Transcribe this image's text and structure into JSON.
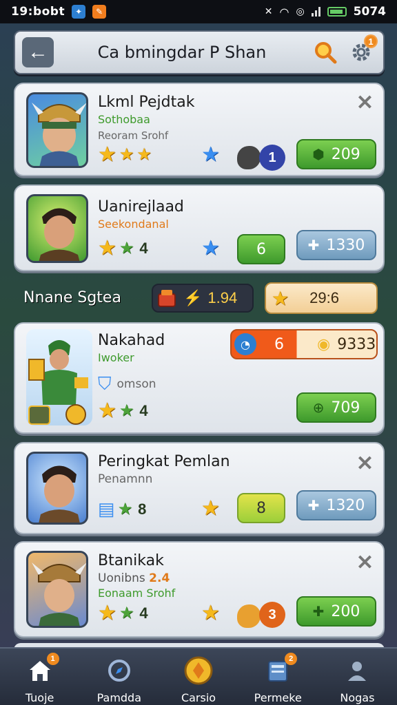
{
  "status_bar": {
    "time": "19:bobt",
    "right_text": "5074"
  },
  "header": {
    "back_icon": "arrow-left-icon",
    "title": "Ca bmingdar P Shan",
    "search_icon": "search-icon",
    "settings_icon": "gear-icon",
    "settings_badge": "1"
  },
  "cards": [
    {
      "name": "Lkml Pejdtak",
      "subtitle": "Sothobaa",
      "subtitle_color": "#3e9a2c",
      "note": "Reoram Srohf",
      "stars_text": "",
      "circle_value": "1",
      "circle_color": "#3344a8",
      "pill_value": "209",
      "pill_style": "green"
    },
    {
      "name": "Uanirejlaad",
      "subtitle": "Seekondanal",
      "subtitle_color": "#e07a1a",
      "stat": "4",
      "green_pill_value": "6",
      "blue_pill_value": "1330"
    },
    {
      "name": "Nakahad",
      "subtitle": "Iwoker",
      "subtitle_color": "#3e9a2c",
      "note": "omson",
      "stat": "4",
      "orange_pill_value": "6",
      "gold_pill_value": "9333",
      "green_pill_value": "709"
    },
    {
      "name": "Peringkat Pemlan",
      "subtitle": "Penamnn",
      "stat": "8",
      "yellow_pill_value": "8",
      "blue_pill_value": "1320"
    },
    {
      "name": "Btanikak",
      "subtitle": "Uonibns",
      "subtitle_suffix": "2.4",
      "note": "Eonaam Srohf",
      "stat": "4",
      "circle_value": "3",
      "circle_color": "#e0641a",
      "pill_value": "200"
    }
  ],
  "section": {
    "title": "Nnane Sgtea",
    "value": "1.94",
    "value_prefix": "⚡",
    "right_value": "29:6"
  },
  "bottom_nav": [
    {
      "label": "Tuoje",
      "icon": "home-icon",
      "badge": "1"
    },
    {
      "label": "Pamdda",
      "icon": "compass-icon",
      "badge": ""
    },
    {
      "label": "Carsio",
      "icon": "coin-icon",
      "badge": ""
    },
    {
      "label": "Permeke",
      "icon": "book-icon",
      "badge": "2"
    },
    {
      "label": "Nogas",
      "icon": "profile-icon",
      "badge": ""
    }
  ]
}
